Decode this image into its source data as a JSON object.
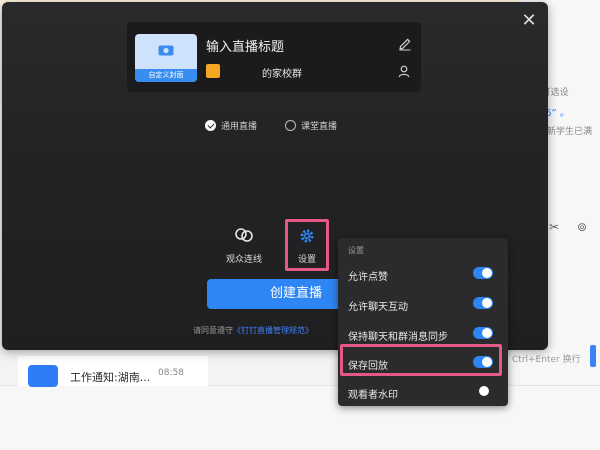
{
  "background": {
    "hint_top": "(可选设",
    "hint_quote": "“-26” 。",
    "hint_sub": "的新学生已满",
    "shortcut": "Ctrl+Enter 换行",
    "notice_title": "工作通知:湖南...",
    "notice_time": "08:58"
  },
  "dialog": {
    "title_placeholder": "输入直播标题",
    "cover_label": "自定义封面",
    "group_name": "的家校群",
    "modes": [
      {
        "label": "通用直播",
        "selected": true
      },
      {
        "label": "课堂直播",
        "selected": false
      }
    ],
    "tools": {
      "connect_label": "观众连线",
      "settings_label": "设置"
    },
    "create_label": "创建直播",
    "agreement_prefix": "请同意遵守",
    "agreement_link": "《钉钉直播管理规范》"
  },
  "settings_popup": {
    "title": "设置",
    "items": [
      {
        "label": "允许点赞",
        "enabled": true
      },
      {
        "label": "允许聊天互动",
        "enabled": true
      },
      {
        "label": "保持聊天和群消息同步",
        "enabled": true
      },
      {
        "label": "保存回放",
        "enabled": true
      },
      {
        "label": "观看者水印",
        "enabled": false
      }
    ]
  },
  "colors": {
    "accent": "#2e86f5",
    "highlight": "#e65889",
    "dialog_bg": "#232325"
  }
}
